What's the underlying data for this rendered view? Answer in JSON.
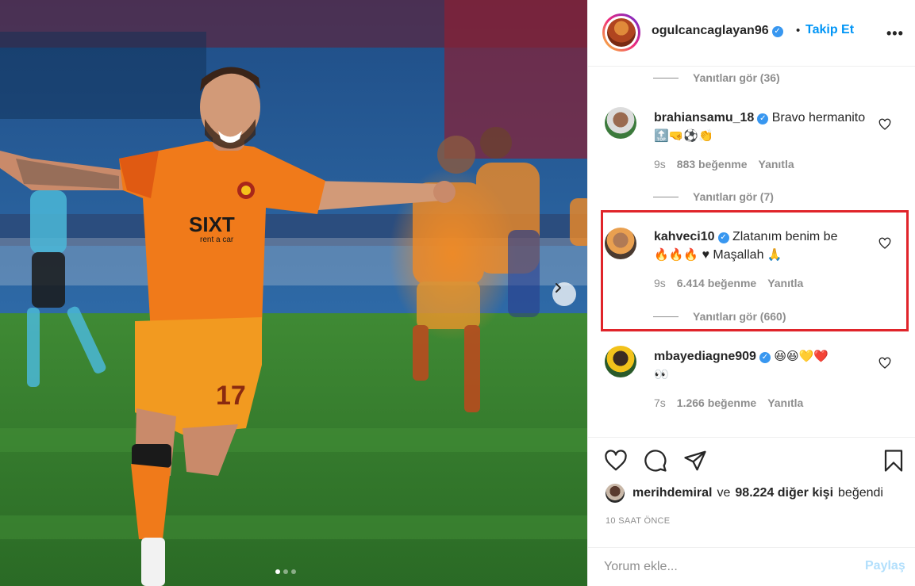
{
  "post": {
    "carousel": {
      "total_slides": 3,
      "active_index": 0,
      "next_icon": "chevron-right-icon"
    },
    "shirt_sponsor": "SIXT",
    "shirt_sponsor_sub": "rent a car",
    "shirt_number": "17"
  },
  "header": {
    "username": "ogulcancaglayan96",
    "verified_icon": "verified-badge-icon",
    "separator": "•",
    "follow_label": "Takip Et",
    "more_icon": "more-options-icon"
  },
  "comments": [
    {
      "replies_label": "Yanıtları gör (36)"
    },
    {
      "username": "brahiansamu_18",
      "text": "Bravo hermanito",
      "emojis": "🔝🤜⚽👏",
      "time": "9s",
      "likes": "883 beğenme",
      "reply_label": "Yanıtla",
      "replies_label": "Yanıtları gör (7)"
    },
    {
      "username": "kahveci10",
      "text": "Zlatanım benim be",
      "emojis": "🔥🔥🔥",
      "text2": "♥ Maşallah",
      "emojis2": "🙏",
      "time": "9s",
      "likes": "6.414 beğenme",
      "reply_label": "Yanıtla",
      "replies_label": "Yanıtları gör (660)"
    },
    {
      "username": "mbayediagne909",
      "emojis": "😆😆💛❤️",
      "emojis2": "👀",
      "time": "7s",
      "likes": "1.266 beğenme",
      "reply_label": "Yanıtla"
    }
  ],
  "actions": {
    "like_icon": "heart-icon",
    "comment_icon": "comment-bubble-icon",
    "share_icon": "paper-plane-icon",
    "save_icon": "bookmark-icon"
  },
  "liked_by": {
    "user": "merihdemiral",
    "connector": "ve",
    "others": "98.224 diğer kişi",
    "suffix": "beğendi"
  },
  "timestamp": "10 SAAT ÖNCE",
  "comment_box": {
    "placeholder": "Yorum ekle...",
    "post_label": "Paylaş"
  },
  "colors": {
    "accent": "#0095f6",
    "highlight_box": "#e0242a",
    "jersey_orange": "#f07a1a",
    "jersey_red": "#a8271a"
  }
}
